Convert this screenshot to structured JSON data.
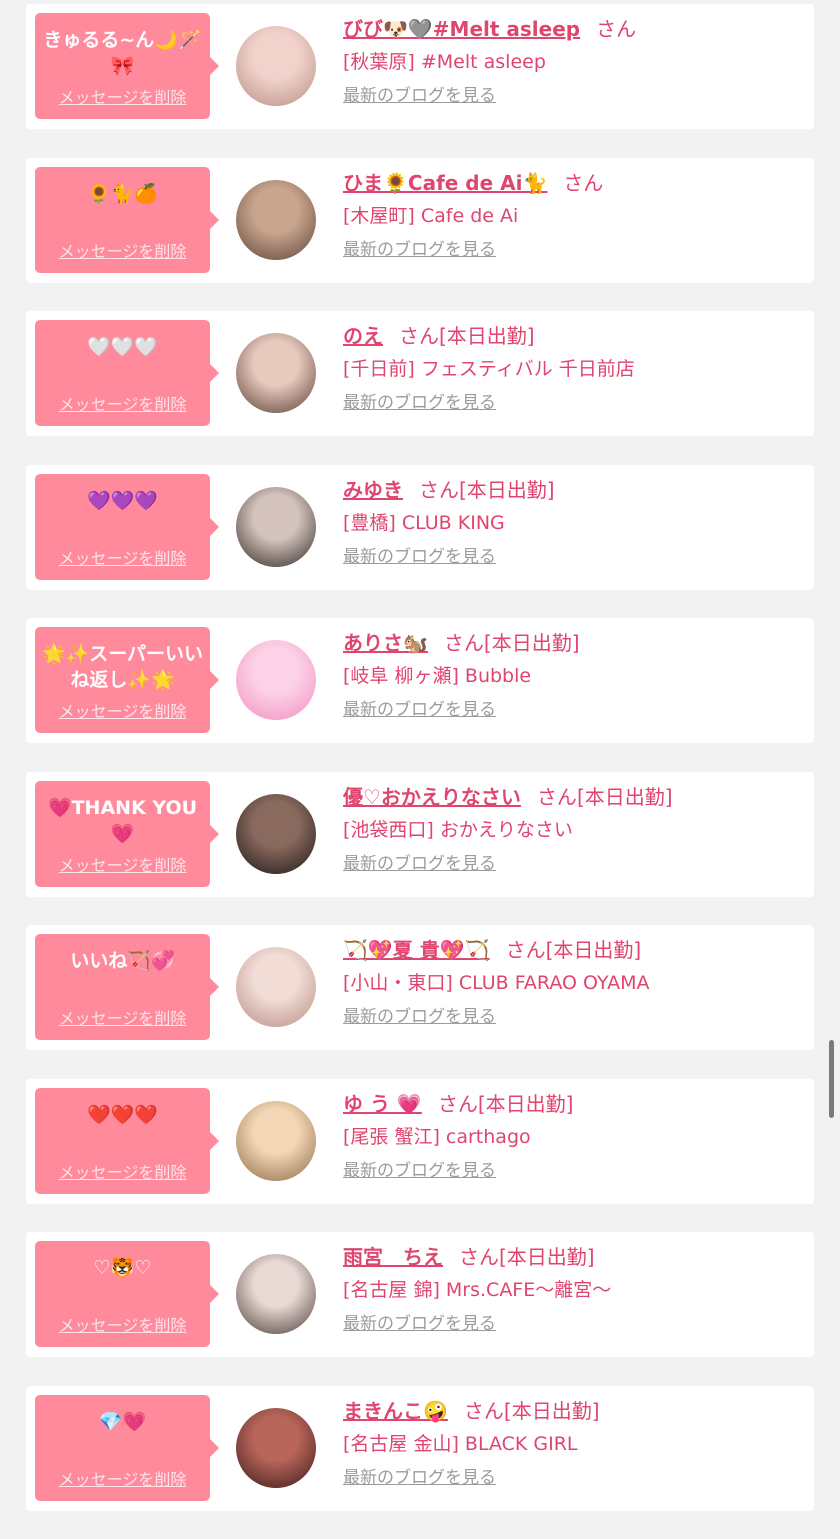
{
  "labels": {
    "delete_message": "メッセージを削除",
    "see_latest_blog": "最新のブログを見る",
    "honorific": "さん"
  },
  "cards": [
    {
      "message": "きゅるる~ん🌙🪄🎀",
      "name": "びび🐶🩶#Melt asleep",
      "status": "",
      "shop": "[秋葉原] #Melt asleep",
      "avatar_colors": [
        "#f2d3cc",
        "#b58f86"
      ]
    },
    {
      "message": "🌻🐈🍊",
      "name": "ひま🌻Cafe de Ai🐈",
      "status": "",
      "shop": "[木屋町] Cafe de Ai",
      "avatar_colors": [
        "#c9a58e",
        "#5d4438"
      ]
    },
    {
      "message": "🤍🤍🤍",
      "name": "のえ",
      "status": "[本日出勤]",
      "shop": "[千日前] フェスティバル 千日前店",
      "avatar_colors": [
        "#e7c9bd",
        "#5a3d34"
      ]
    },
    {
      "message": "💜💜💜",
      "name": "みゆき",
      "status": "[本日出勤]",
      "shop": "[豊橋] CLUB KING",
      "avatar_colors": [
        "#d4c4bd",
        "#2f2623"
      ]
    },
    {
      "message": "🌟✨スーパーいいね返し✨🌟",
      "name": "ありさ🐿️",
      "status": "[本日出勤]",
      "shop": "[岐阜 柳ヶ瀬] Bubble",
      "avatar_colors": [
        "#fbd2e6",
        "#f28ec0"
      ]
    },
    {
      "message": "💗THANK YOU💗",
      "name": "優♡おかえりなさい",
      "status": "[本日出勤]",
      "shop": "[池袋西口] おかえりなさい",
      "avatar_colors": [
        "#8a6a5e",
        "#1c1717"
      ]
    },
    {
      "message": "いいね🏹💞",
      "name": "🏹💖夏 貴💖🏹",
      "status": "[本日出勤]",
      "shop": "[小山・東口] CLUB FARAO OYAMA",
      "avatar_colors": [
        "#f1dcd6",
        "#b68d82"
      ]
    },
    {
      "message": "❤️❤️❤️",
      "name": "ゆ う 💗",
      "status": "[本日出勤]",
      "shop": "[尾張 蟹江] carthago",
      "avatar_colors": [
        "#f3d6b5",
        "#8c6a45"
      ]
    },
    {
      "message": "♡🐯♡",
      "name": "雨宮　ちえ",
      "status": "[本日出勤]",
      "shop": "[名古屋 錦] Mrs.CAFE〜離宮〜",
      "avatar_colors": [
        "#e9d9d5",
        "#4a3a36"
      ]
    },
    {
      "message": "💎💗",
      "name": "まきんこ🤪",
      "status": "[本日出勤]",
      "shop": "[名古屋 金山] BLACK GIRL",
      "avatar_colors": [
        "#b8655a",
        "#3a1a18"
      ]
    }
  ]
}
